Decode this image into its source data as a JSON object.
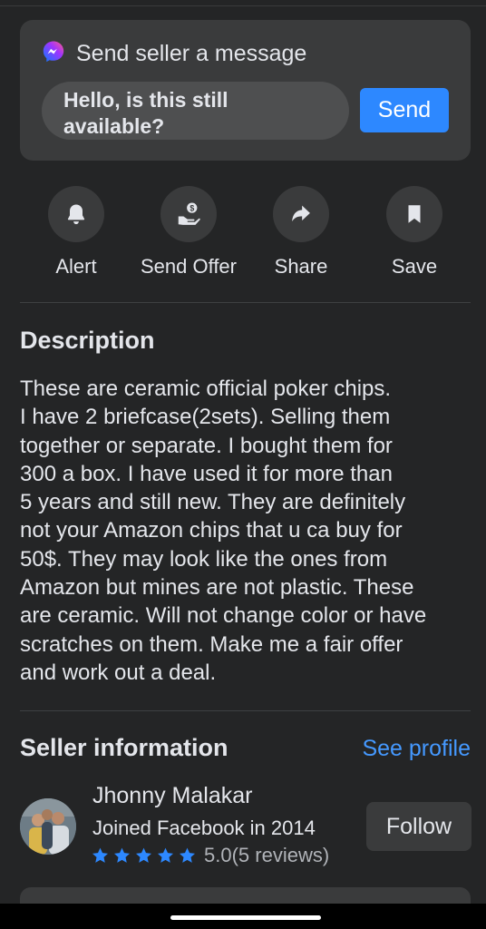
{
  "message": {
    "title": "Send seller a message",
    "input_value": "Hello, is this still available?",
    "send_label": "Send"
  },
  "actions": [
    {
      "label": "Alert",
      "icon": "bell-icon"
    },
    {
      "label": "Send Offer",
      "icon": "offer-icon"
    },
    {
      "label": "Share",
      "icon": "share-icon"
    },
    {
      "label": "Save",
      "icon": "bookmark-icon"
    }
  ],
  "description": {
    "title": "Description",
    "body": "These are ceramic official  poker chips.\nI have 2 briefcase(2sets). Selling them\ntogether or separate. I bought them for\n300 a box. I have used it for more than\n5 years and still new. They are definitely\nnot your Amazon chips that u ca buy for\n50$. They may look like the ones from\nAmazon but mines are not plastic. These\nare ceramic. Will not change color or have\nscratches on them. Make me a fair offer\nand work out a deal."
  },
  "seller": {
    "title": "Seller information",
    "see_profile": "See profile",
    "name": "Jhonny Malakar",
    "joined": "Joined Facebook in 2014",
    "rating": "5.0",
    "stars": 5,
    "reviews": "(5 reviews)",
    "follow_label": "Follow"
  },
  "colors": {
    "background": "#242526",
    "card": "#3a3b3c",
    "accent": "#2d88ff",
    "link": "#4599ff",
    "star": "#2d88ff"
  }
}
